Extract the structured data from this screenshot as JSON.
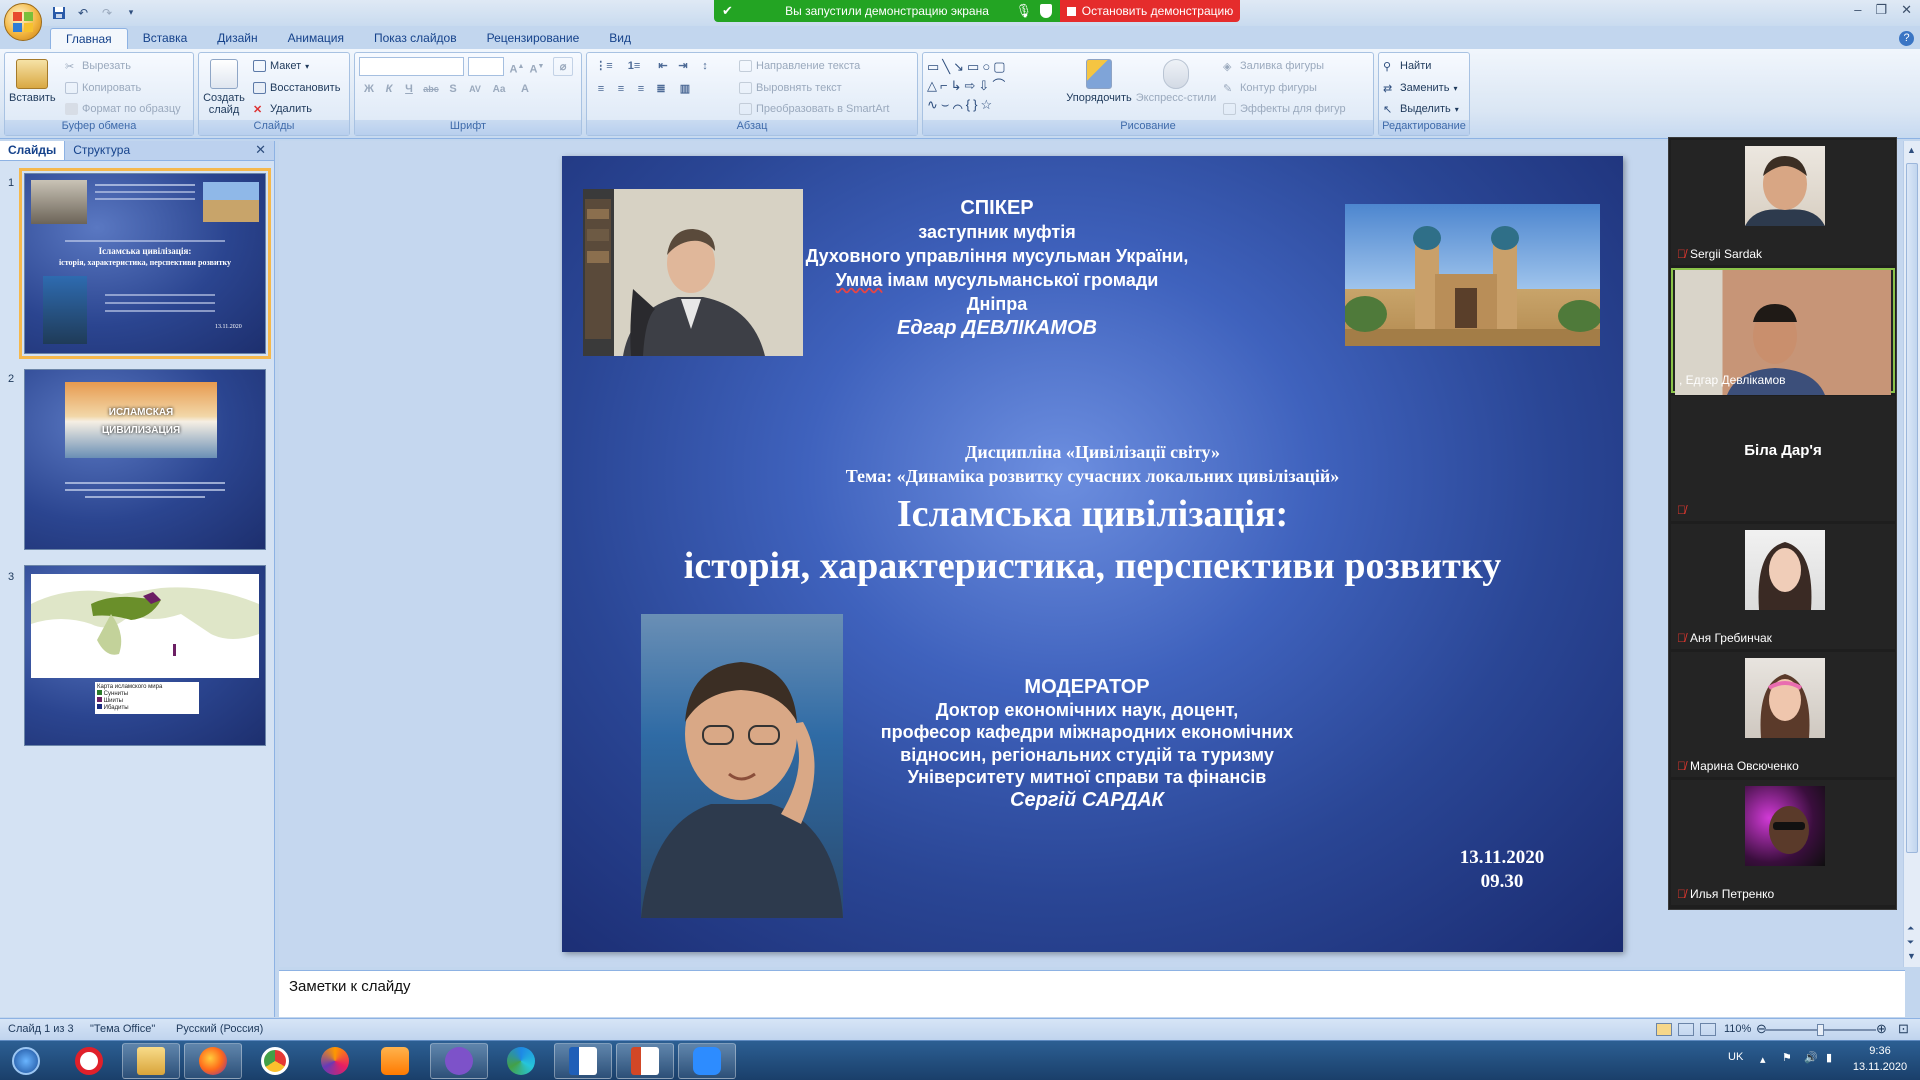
{
  "window": {
    "share_notice": "Вы запустили демонстрацию экрана",
    "stop_share": "Остановить демонстрацию"
  },
  "tabs": [
    "Главная",
    "Вставка",
    "Дизайн",
    "Анимация",
    "Показ слайдов",
    "Рецензирование",
    "Вид"
  ],
  "ribbon": {
    "clipboard": {
      "paste": "Вставить",
      "cut": "Вырезать",
      "copy": "Копировать",
      "format_painter": "Формат по образцу",
      "label": "Буфер обмена"
    },
    "slides": {
      "new_slide": "Создать слайд",
      "layout": "Макет",
      "reset": "Восстановить",
      "delete": "Удалить",
      "label": "Слайды"
    },
    "font": {
      "label": "Шрифт"
    },
    "paragraph": {
      "text_direction": "Направление текста",
      "align_text": "Выровнять текст",
      "smartart": "Преобразовать в SmartArt",
      "label": "Абзац"
    },
    "drawing": {
      "arrange": "Упорядочить",
      "quick_styles": "Экспресс-стили",
      "shape_fill": "Заливка фигуры",
      "shape_outline": "Контур фигуры",
      "shape_effects": "Эффекты для фигур",
      "label": "Рисование"
    },
    "editing": {
      "find": "Найти",
      "replace": "Заменить",
      "select": "Выделить",
      "label": "Редактирование"
    }
  },
  "left_pane": {
    "tab_slides": "Слайды",
    "tab_outline": "Структура",
    "thumb2_title": "ИСЛАМСКАЯ ЦИВИЛИЗАЦИЯ",
    "thumb3_legend_title": "Карта исламского мира",
    "thumb3_legend": [
      "Сунниты",
      "Шииты",
      "Ибадиты"
    ]
  },
  "slide": {
    "speaker_heading": "СПІКЕР",
    "speaker_role_1": "заступник муфтія",
    "speaker_role_2": "Духовного управління мусульман України,",
    "speaker_role_3a": "Умма",
    "speaker_role_3b": " імам мусульманської громади",
    "speaker_role_4": "Дніпра",
    "speaker_name": "Едгар ДЕВЛІКАМОВ",
    "discipline": "Дисципліна «Цивілізації світу»",
    "topic": "Тема: «Динаміка розвитку сучасних локальних цивілізацій»",
    "title_1": "Ісламська цивілізація:",
    "title_2": "історія, характеристика, перспективи розвитку",
    "moderator_heading": "МОДЕРАТОР",
    "moderator_1": "Доктор економічних наук, доцент,",
    "moderator_2": "професор  кафедри міжнародних економічних",
    "moderator_3": "відносин, регіональних студій та туризму",
    "moderator_4": "Університету митної справи та фінансів",
    "moderator_name": "Сергій САРДАК",
    "date": "13.11.2020",
    "time": "09.30"
  },
  "notes_placeholder": "Заметки к слайду",
  "status": {
    "slide_of": "Слайд 1 из 3",
    "theme": "\"Тема Office\"",
    "language": "Русский (Россия)",
    "zoom": "110%"
  },
  "participants": [
    {
      "name": "Sergii Sardak",
      "has_video": true,
      "active": false
    },
    {
      "name": ", Едгар Девлікамов",
      "has_video": true,
      "active": true
    },
    {
      "name": "Біла Дар'я",
      "has_video": false,
      "active": false
    },
    {
      "name": "Аня Гребинчак",
      "has_video": true,
      "active": false
    },
    {
      "name": "Марина Овсюченко",
      "has_video": true,
      "active": false
    },
    {
      "name": "Илья Петренко",
      "has_video": true,
      "active": false
    }
  ],
  "tray": {
    "lang": "UK",
    "time": "9:36",
    "date": "13.11.2020"
  }
}
